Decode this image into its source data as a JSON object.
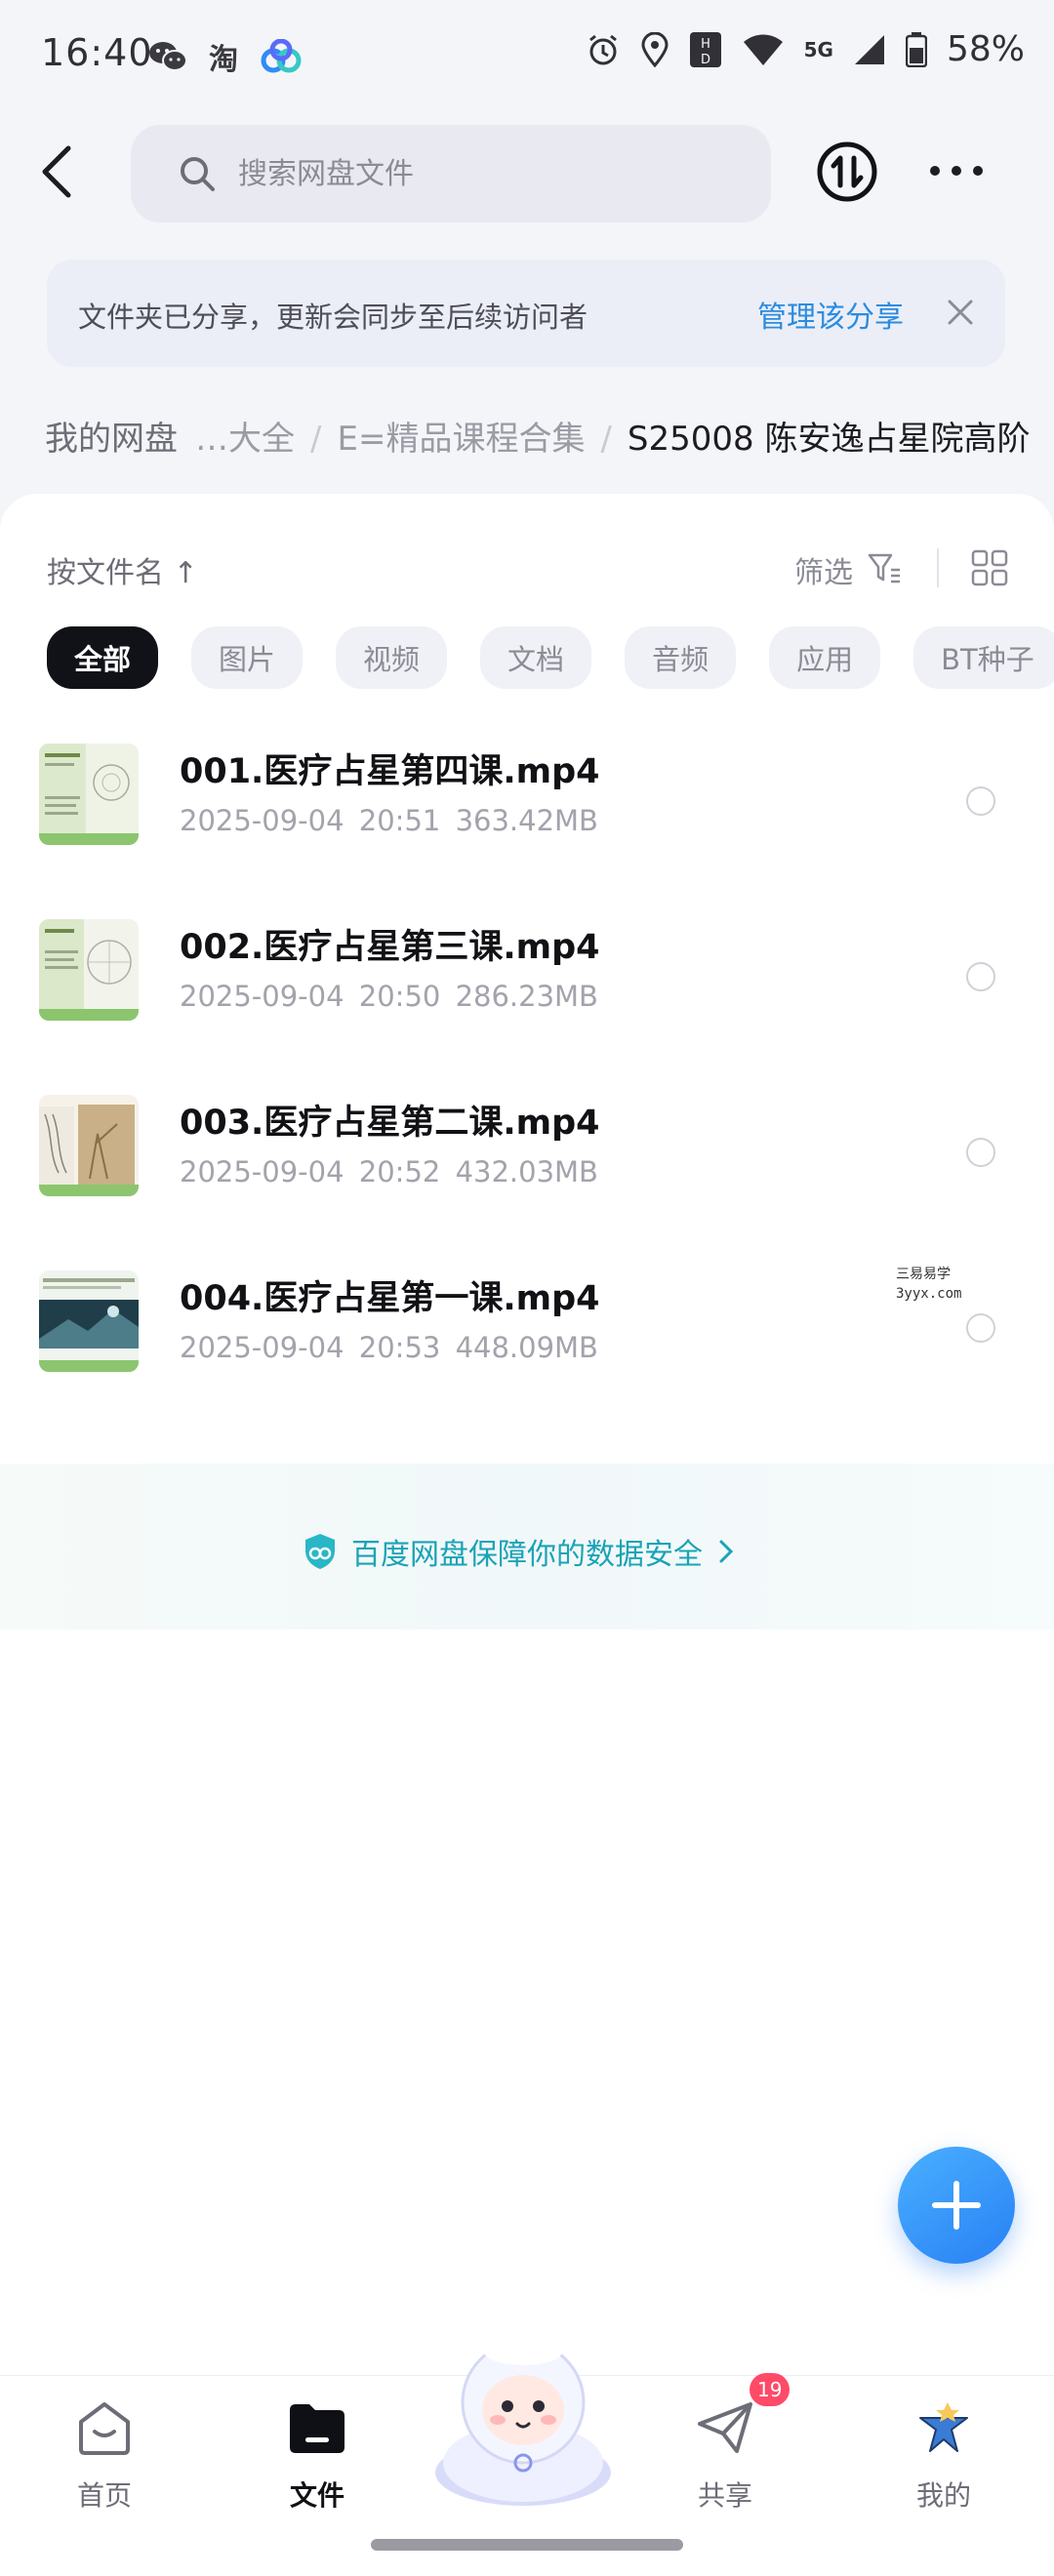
{
  "status_bar": {
    "time": "16:40",
    "taobao_glyph": "淘",
    "battery_percent": "58%",
    "network": "5G",
    "icons": [
      "wechat-icon",
      "taobao-icon",
      "baidu-cloud-icon",
      "alarm-icon",
      "location-icon",
      "hd-icon",
      "wifi-icon",
      "signal-icon",
      "battery-icon"
    ]
  },
  "topbar": {
    "search_placeholder": "搜索网盘文件"
  },
  "share_banner": {
    "text": "文件夹已分享，更新会同步至后续访问者",
    "action": "管理该分享"
  },
  "breadcrumb": {
    "root": "我的网盘",
    "trail": [
      "…大全",
      "E=精品课程合集",
      "S25008 陈安逸占星院高阶"
    ]
  },
  "toolbar": {
    "sort_label": "按文件名 ↑",
    "filter_label": "筛选"
  },
  "categories": [
    "全部",
    "图片",
    "视频",
    "文档",
    "音频",
    "应用",
    "BT种子"
  ],
  "files": [
    {
      "name": "001.医疗占星第四课.mp4",
      "date": "2025-09-04",
      "time": "20:51",
      "size": "363.42MB"
    },
    {
      "name": "002.医疗占星第三课.mp4",
      "date": "2025-09-04",
      "time": "20:50",
      "size": "286.23MB"
    },
    {
      "name": "003.医疗占星第二课.mp4",
      "date": "2025-09-04",
      "time": "20:52",
      "size": "432.03MB"
    },
    {
      "name": "004.医疗占星第一课.mp4",
      "date": "2025-09-04",
      "time": "20:53",
      "size": "448.09MB"
    }
  ],
  "watermark": {
    "line1": "三易易学",
    "line2": "3yyx.com"
  },
  "security_text": "百度网盘保障你的数据安全",
  "bottom_nav": {
    "home": "首页",
    "files": "文件",
    "share": "共享",
    "mine": "我的",
    "share_badge": "19"
  },
  "colors": {
    "accent": "#2a8ce0",
    "security": "#1aa3b6",
    "badge": "#ff4a68",
    "fab": "#2f8cf6",
    "active_chip": "#101218"
  }
}
